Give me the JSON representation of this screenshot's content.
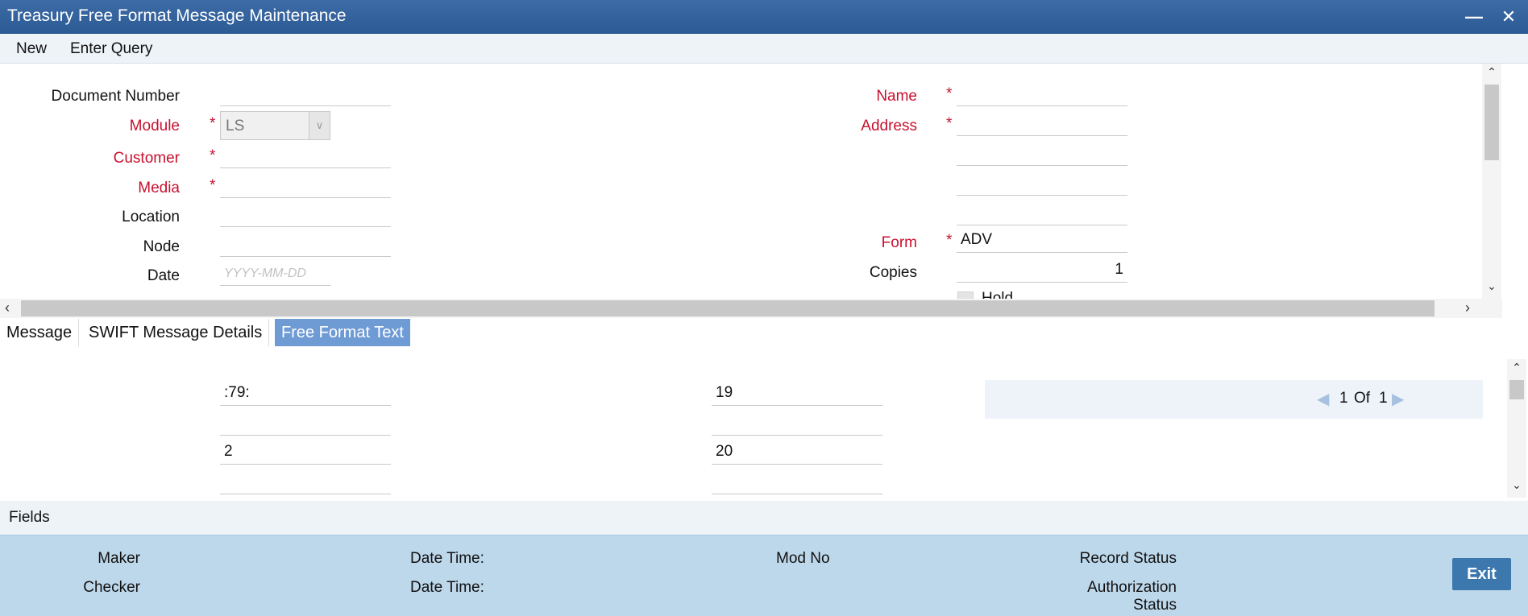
{
  "window": {
    "title": "Treasury Free Format Message Maintenance",
    "minimize_glyph": "—",
    "close_glyph": "✕"
  },
  "menu": {
    "new": "New",
    "enter_query": "Enter Query"
  },
  "form": {
    "left": {
      "document_number": {
        "label": "Document Number",
        "value": ""
      },
      "module": {
        "label": "Module",
        "value": "LS",
        "required": true
      },
      "customer": {
        "label": "Customer",
        "value": "",
        "required": true
      },
      "media": {
        "label": "Media",
        "value": "",
        "required": true
      },
      "location": {
        "label": "Location",
        "value": ""
      },
      "node": {
        "label": "Node",
        "value": ""
      },
      "date": {
        "label": "Date",
        "placeholder": "YYYY-MM-DD"
      }
    },
    "right": {
      "name": {
        "label": "Name",
        "value": "",
        "required": true
      },
      "address": {
        "label": "Address",
        "lines": [
          "",
          "",
          "",
          ""
        ],
        "required": true
      },
      "form": {
        "label": "Form",
        "value": "ADV",
        "required": true
      },
      "copies": {
        "label": "Copies",
        "value": "1"
      },
      "hold": {
        "label": "Hold"
      }
    },
    "required_marker": "*"
  },
  "tabs": [
    {
      "label": "Message",
      "active": false
    },
    {
      "label": "SWIFT Message Details",
      "active": false
    },
    {
      "label": "Free Format Text",
      "active": true
    }
  ],
  "free_format": {
    "col1": [
      ":79:",
      "",
      "2",
      ""
    ],
    "col2": [
      "19",
      "",
      "20",
      ""
    ],
    "pager": {
      "current": "1",
      "of_label": "Of",
      "total": "1"
    }
  },
  "fields_bar": {
    "label": "Fields"
  },
  "footer": {
    "maker": "Maker",
    "checker": "Checker",
    "date_time_1": "Date Time:",
    "date_time_2": "Date Time:",
    "mod_no": "Mod No",
    "record_status": "Record Status",
    "authorization_status_line1": "Authorization",
    "authorization_status_line2": "Status",
    "exit": "Exit"
  },
  "colors": {
    "title_bar": "#2c5a93",
    "required": "#c8102e",
    "active_tab": "#6f9bd5",
    "footer": "#bed8eb",
    "exit_button": "#3c77ad"
  }
}
